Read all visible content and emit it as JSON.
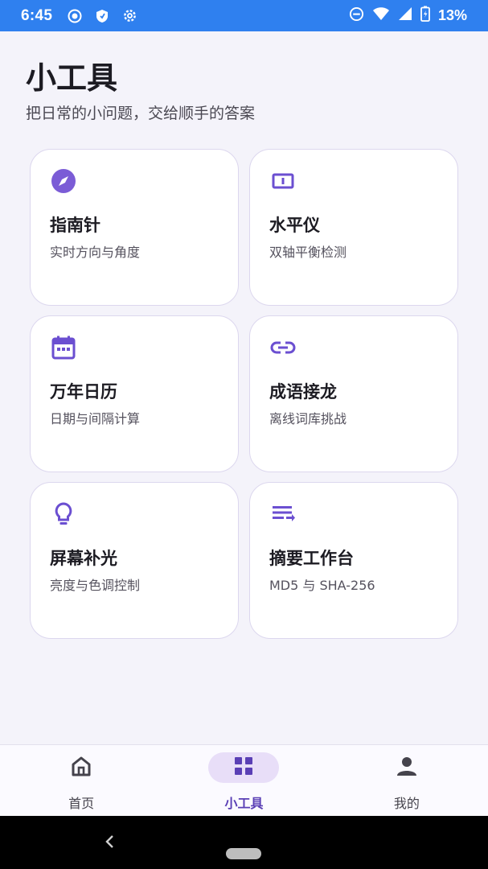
{
  "status_bar": {
    "time": "6:45",
    "battery_percent": "13%",
    "left_icons": [
      "record-icon",
      "shield-icon",
      "settings-icon"
    ],
    "right_icons": [
      "dnd-icon",
      "wifi-icon",
      "signal-icon",
      "battery-icon"
    ]
  },
  "header": {
    "title": "小工具",
    "subtitle": "把日常的小问题，交给顺手的答案"
  },
  "tools": [
    {
      "title": "指南针",
      "desc": "实时方向与角度",
      "icon": "compass-icon"
    },
    {
      "title": "水平仪",
      "desc": "双轴平衡检测",
      "icon": "level-icon"
    },
    {
      "title": "万年日历",
      "desc": "日期与间隔计算",
      "icon": "calendar-icon"
    },
    {
      "title": "成语接龙",
      "desc": "离线词库挑战",
      "icon": "link-icon"
    },
    {
      "title": "屏幕补光",
      "desc": "亮度与色调控制",
      "icon": "lightbulb-icon"
    },
    {
      "title": "摘要工作台",
      "desc": "MD5 与 SHA-256",
      "icon": "text-list-icon"
    }
  ],
  "bottom_nav": {
    "items": [
      {
        "label": "首页",
        "icon": "home-icon"
      },
      {
        "label": "小工具",
        "icon": "grid-icon",
        "active": true
      },
      {
        "label": "我的",
        "icon": "person-icon"
      }
    ]
  },
  "colors": {
    "accent": "#6b4fd1",
    "status_bar": "#2f80ef",
    "background": "#f4f3fa",
    "active_pill": "#e8def8"
  }
}
